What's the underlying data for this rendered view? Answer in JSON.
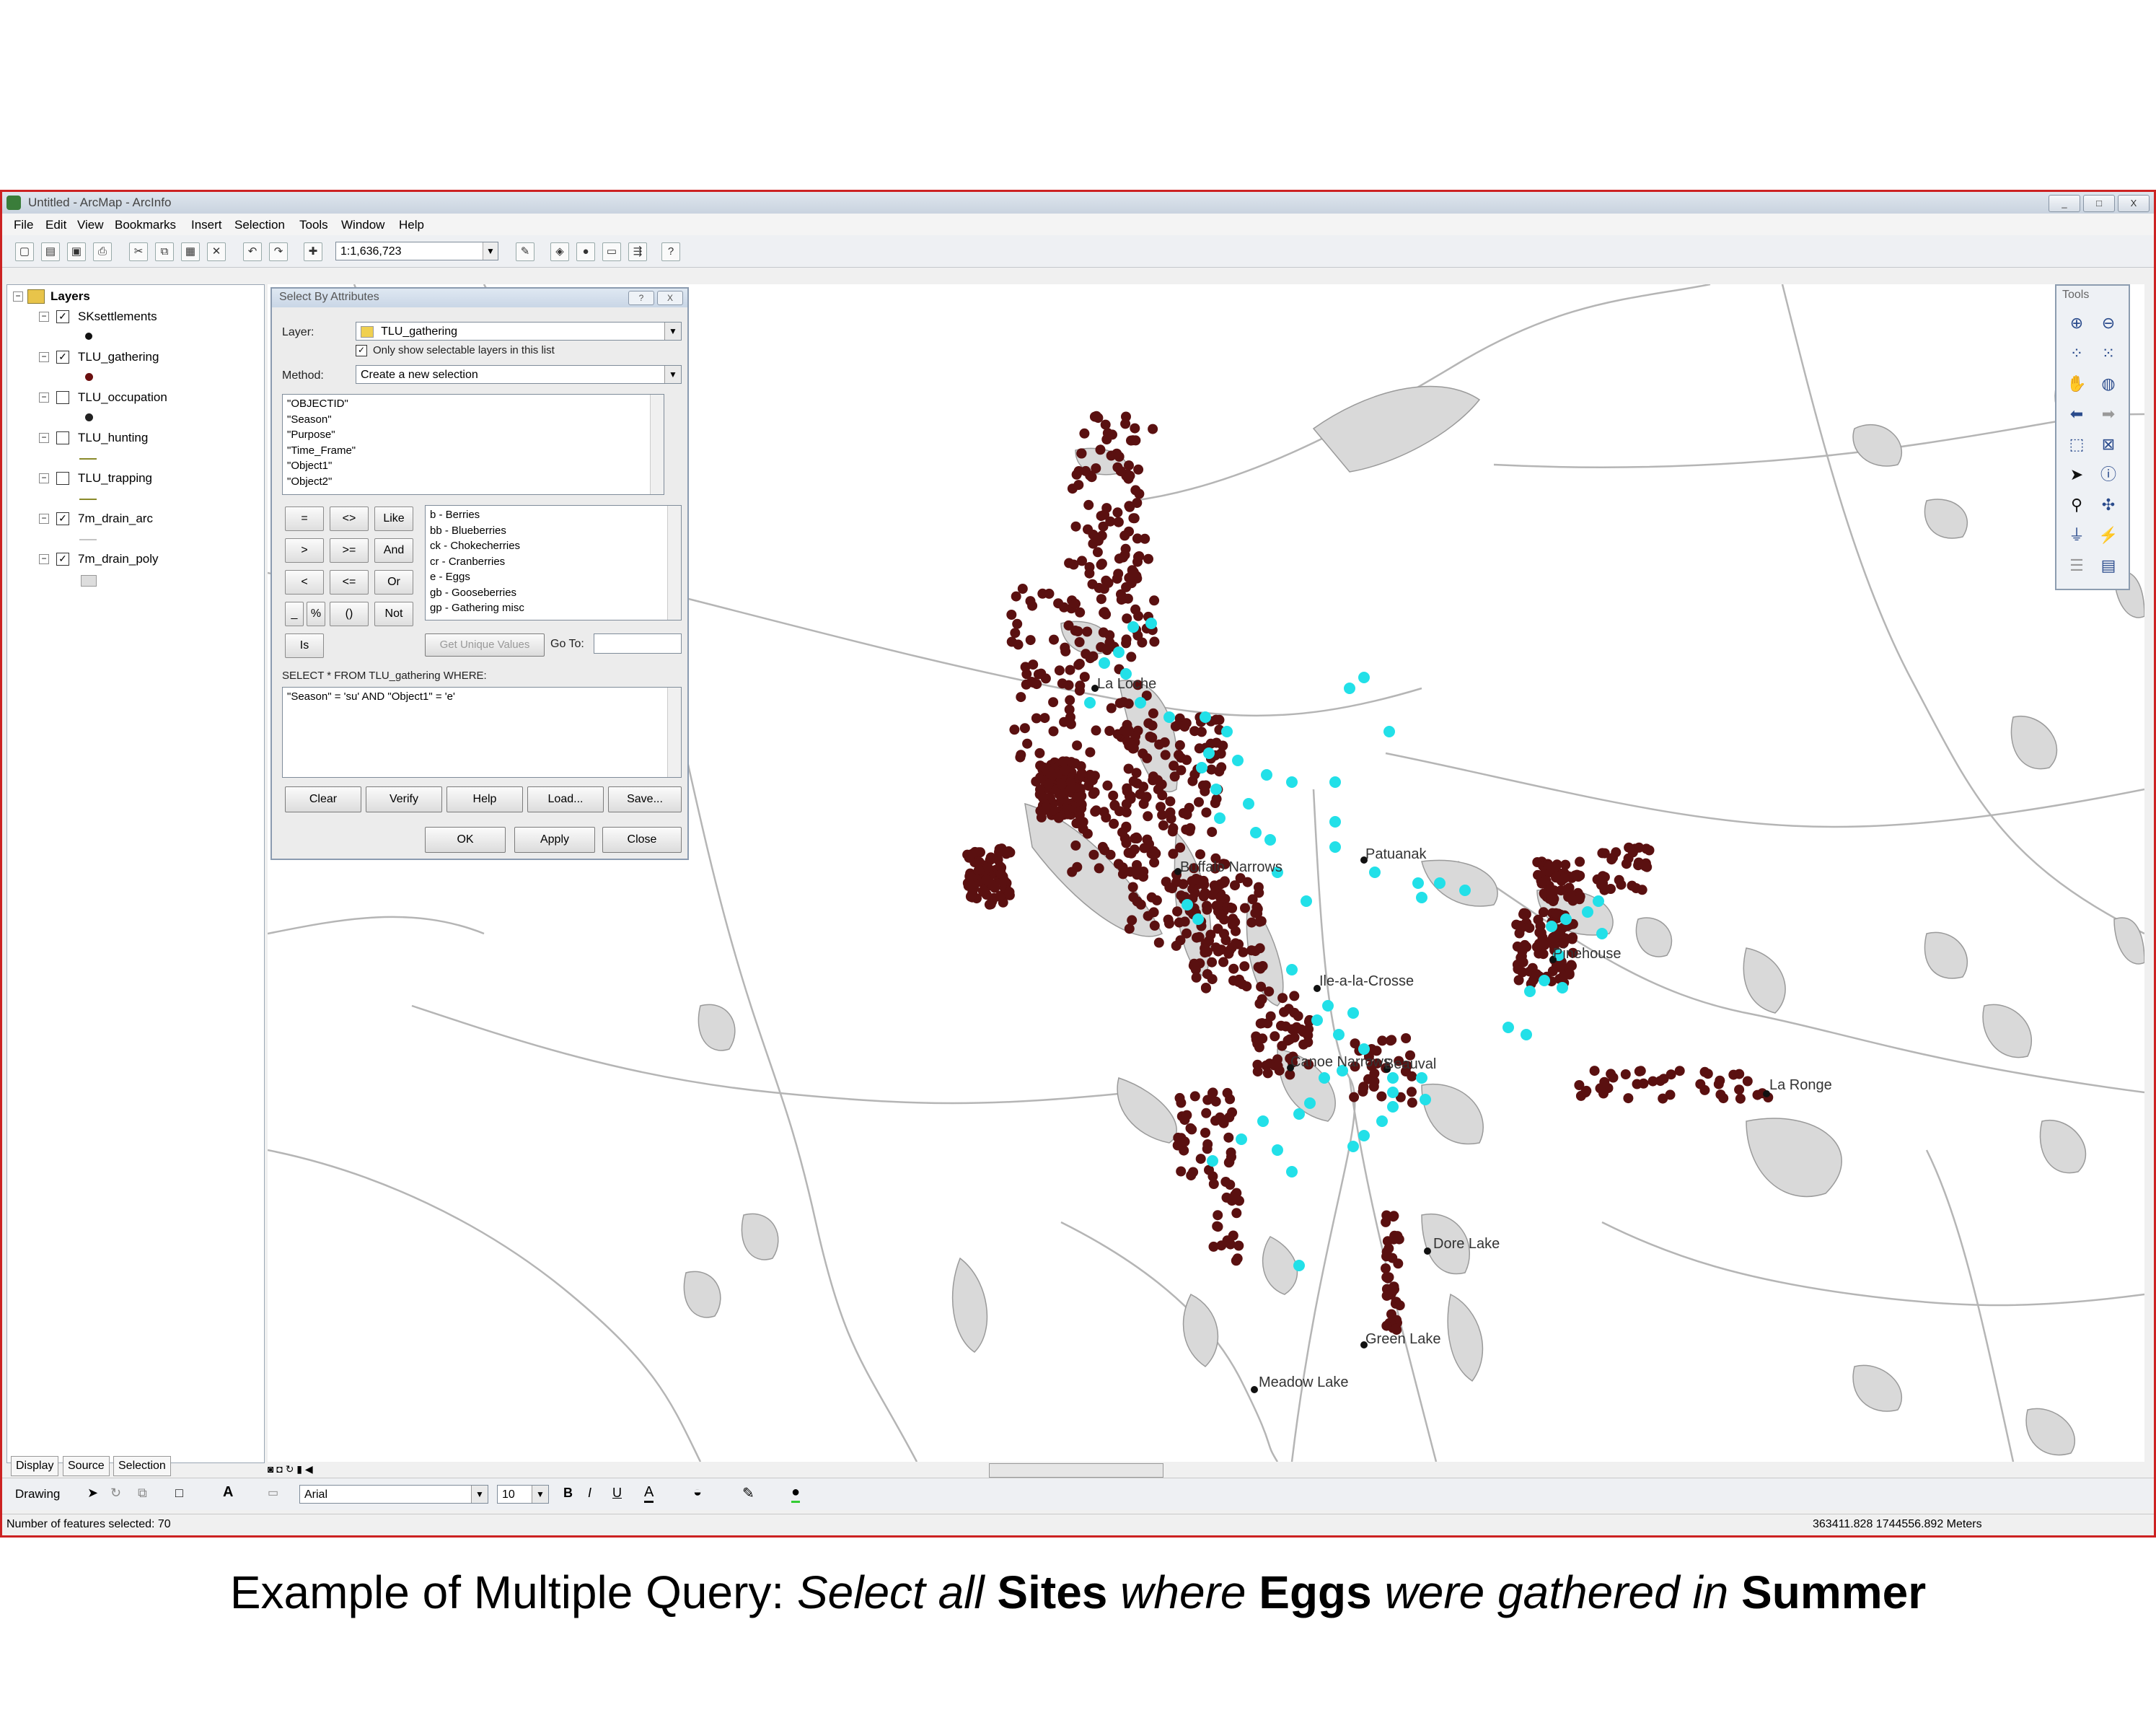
{
  "window": {
    "title": "Untitled - ArcMap - ArcInfo",
    "buttons": [
      "_",
      "□",
      "X"
    ]
  },
  "menu": [
    "File",
    "Edit",
    "View",
    "Bookmarks",
    "Insert",
    "Selection",
    "Tools",
    "Window",
    "Help"
  ],
  "toolbar": {
    "scale": "1:1,636,723"
  },
  "toc": {
    "root": "Layers",
    "layers": [
      {
        "name": "SKsettlements",
        "checked": true,
        "symbol": "point-black"
      },
      {
        "name": "TLU_gathering",
        "checked": true,
        "symbol": "point-maroon"
      },
      {
        "name": "TLU_occupation",
        "checked": false,
        "symbol": "point-black"
      },
      {
        "name": "TLU_hunting",
        "checked": false,
        "symbol": "line-olive"
      },
      {
        "name": "TLU_trapping",
        "checked": false,
        "symbol": "line-olive"
      },
      {
        "name": "7m_drain_arc",
        "checked": true,
        "symbol": "line-grey"
      },
      {
        "name": "7m_drain_poly",
        "checked": true,
        "symbol": "poly-grey"
      }
    ],
    "tabs": [
      "Display",
      "Source",
      "Selection"
    ]
  },
  "dialog": {
    "title": "Select By Attributes",
    "title_buttons": [
      "?",
      "X"
    ],
    "layer_label": "Layer:",
    "layer_value": "TLU_gathering",
    "only_selectable": "Only show selectable layers in this list",
    "method_label": "Method:",
    "method_value": "Create a new selection",
    "fields": [
      "\"OBJECTID\"",
      "\"Season\"",
      "\"Purpose\"",
      "\"Time_Frame\"",
      "\"Object1\"",
      "\"Object2\""
    ],
    "operators": [
      "=",
      "<>",
      "Like",
      ">",
      ">=",
      "And",
      "<",
      "<=",
      "Or",
      "_",
      "%",
      "()",
      "Not",
      "Is"
    ],
    "values": [
      "b - Berries",
      "bb - Blueberries",
      "ck - Chokecherries",
      "cr - Cranberries",
      "e - Eggs",
      "gb - Gooseberries",
      "gp - Gathering misc"
    ],
    "get_unique": "Get Unique Values",
    "goto_label": "Go To:",
    "select_clause": "SELECT * FROM TLU_gathering WHERE:",
    "expression": "\"Season\" = 'su' AND \"Object1\" = 'e'",
    "buttons": [
      "Clear",
      "Verify",
      "Help",
      "Load...",
      "Save..."
    ],
    "footer_buttons": [
      "OK",
      "Apply",
      "Close"
    ]
  },
  "tools_panel": {
    "title": "Tools"
  },
  "map": {
    "towns": [
      "La Loche",
      "Buffalo Narrows",
      "Patuanak",
      "Pinehouse",
      "Ile-a-la-Crosse",
      "Beauval",
      "Canoe Narrows",
      "La Ronge",
      "Dore Lake",
      "Green Lake",
      "Meadow Lake"
    ],
    "colors": {
      "gathering": "#5a1010",
      "selected": "#22e0e8",
      "settlement": "#111111",
      "lake": "#d9d9d9",
      "river": "#b5b5b5"
    }
  },
  "drawing": {
    "label": "Drawing",
    "font": "Arial",
    "size": "10"
  },
  "status": {
    "left": "Number of features selected: 70",
    "right": "363411.828  1744556.892 Meters"
  },
  "caption": {
    "prefix": "Example of Multiple Query: ",
    "p1": "Select all ",
    "b1": "Sites",
    "p2": " where ",
    "b2": "Eggs",
    "p3": " were gathered ",
    "p4": "in ",
    "b3": "Summer"
  }
}
